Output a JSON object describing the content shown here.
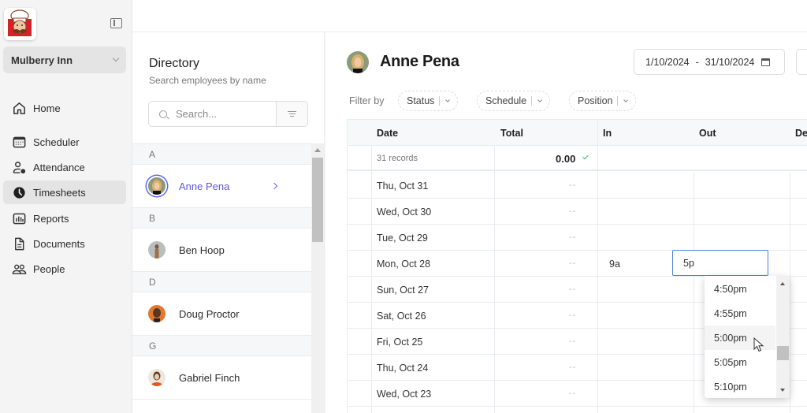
{
  "sidebar": {
    "logo": "chef-logo",
    "org_name": "Mulberry Inn",
    "items": [
      {
        "label": "Home",
        "icon": "home-icon",
        "active": false
      },
      {
        "label": "Scheduler",
        "icon": "calendar-icon",
        "active": false
      },
      {
        "label": "Attendance",
        "icon": "user-clock-icon",
        "active": false
      },
      {
        "label": "Timesheets",
        "icon": "clock-icon",
        "active": true
      },
      {
        "label": "Reports",
        "icon": "bar-chart-icon",
        "active": false
      },
      {
        "label": "Documents",
        "icon": "document-icon",
        "active": false
      },
      {
        "label": "People",
        "icon": "people-icon",
        "active": false
      }
    ]
  },
  "directory": {
    "title": "Directory",
    "subtitle": "Search employees by name",
    "search_placeholder": "Search...",
    "groups": [
      {
        "letter": "A",
        "people": [
          {
            "name": "Anne Pena",
            "selected": true,
            "avatar_color": "#c9a25f"
          }
        ]
      },
      {
        "letter": "B",
        "people": [
          {
            "name": "Ben Hoop",
            "selected": false,
            "avatar_color": "#9aa3a0"
          }
        ]
      },
      {
        "letter": "D",
        "people": [
          {
            "name": "Doug Proctor",
            "selected": false,
            "avatar_color": "#e0782f"
          }
        ]
      },
      {
        "letter": "G",
        "people": [
          {
            "name": "Gabriel Finch",
            "selected": false,
            "avatar_color": "#e9e5dc"
          }
        ]
      }
    ]
  },
  "main": {
    "employee_name": "Anne Pena",
    "date_from": "1/10/2024",
    "date_sep": "-",
    "date_to": "31/10/2024",
    "filter_label": "Filter by",
    "filters": [
      "Status",
      "Schedule",
      "Position"
    ],
    "table": {
      "columns": [
        "Date",
        "Total",
        "In",
        "Out",
        "De"
      ],
      "summary": {
        "records": "31 records",
        "total": "0.00"
      },
      "rows": [
        {
          "date": "Thu, Oct 31",
          "total": "--",
          "in": "",
          "out": ""
        },
        {
          "date": "Wed, Oct 30",
          "total": "--",
          "in": "",
          "out": ""
        },
        {
          "date": "Tue, Oct 29",
          "total": "--",
          "in": "",
          "out": ""
        },
        {
          "date": "Mon, Oct 28",
          "total": "--",
          "in": "9a",
          "out": "5p"
        },
        {
          "date": "Sun, Oct 27",
          "total": "--",
          "in": "",
          "out": ""
        },
        {
          "date": "Sat, Oct 26",
          "total": "--",
          "in": "",
          "out": ""
        },
        {
          "date": "Fri, Oct 25",
          "total": "--",
          "in": "",
          "out": ""
        },
        {
          "date": "Thu, Oct 24",
          "total": "--",
          "in": "",
          "out": ""
        },
        {
          "date": "Wed, Oct 23",
          "total": "--",
          "in": "",
          "out": ""
        }
      ]
    },
    "out_input_value": "5p",
    "time_dropdown": {
      "options": [
        "4:50pm",
        "4:55pm",
        "5:00pm",
        "5:05pm",
        "5:10pm"
      ],
      "hovered": "5:00pm"
    }
  },
  "colors": {
    "accent": "#6366f1",
    "focus": "#4a7fe0",
    "success": "#22c55e"
  }
}
